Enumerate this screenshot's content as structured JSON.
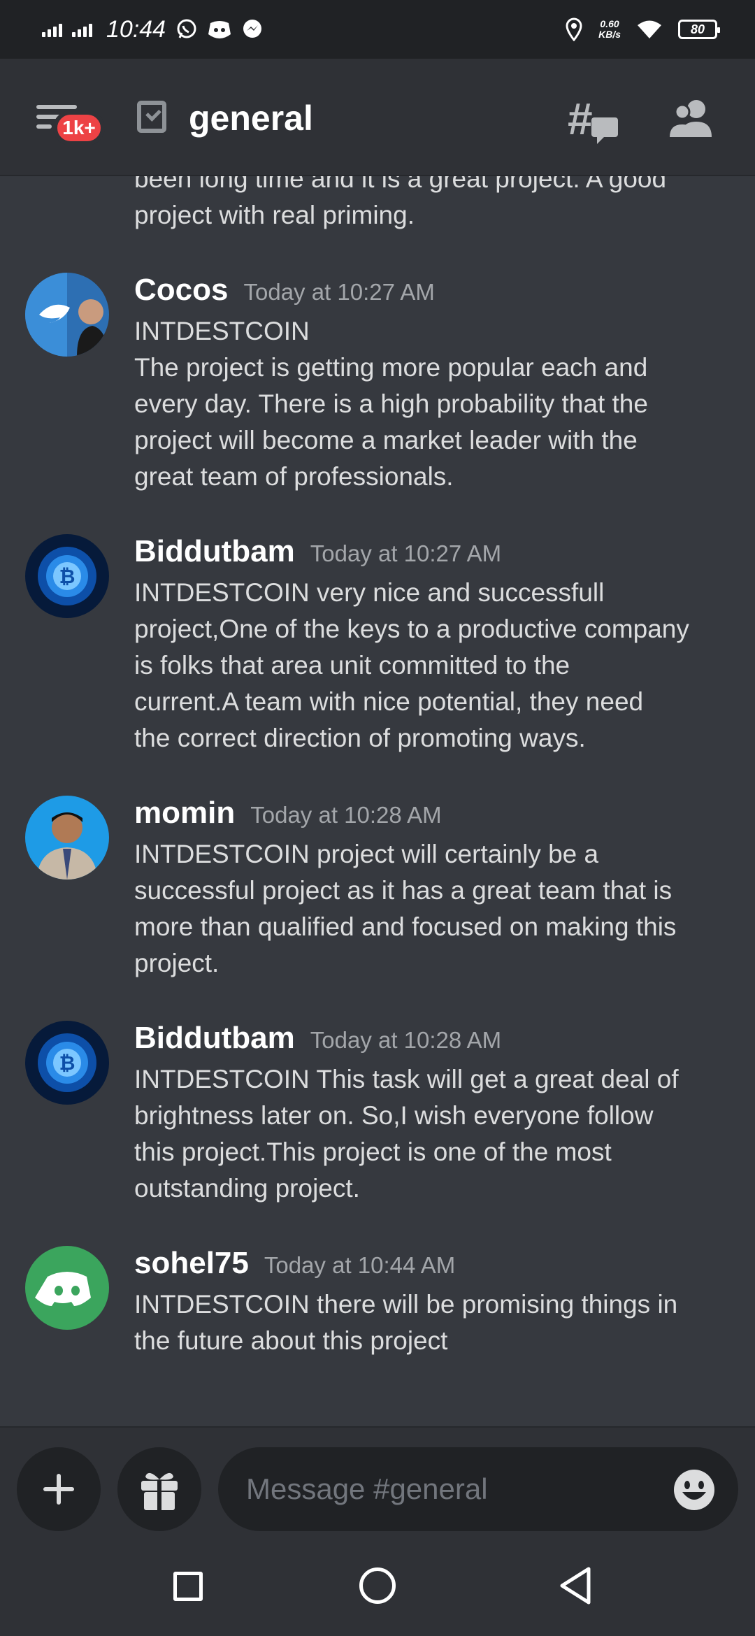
{
  "status_bar": {
    "time": "10:44",
    "network_speed_value": "0.60",
    "network_speed_unit": "KB/s",
    "battery": "80",
    "icons": [
      "signal-icon",
      "signal-icon",
      "whatsapp-icon",
      "discord-notif-icon",
      "messenger-icon",
      "location-icon",
      "wifi-icon",
      "battery-icon"
    ]
  },
  "header": {
    "badge": "1k+",
    "channel_name": "general",
    "icons": [
      "hamburger-menu-icon",
      "channel-icon",
      "threads-icon",
      "members-icon"
    ]
  },
  "messages": {
    "partial_top": [
      "been  long time and it is a great project. A good",
      "project with real priming."
    ],
    "items": [
      {
        "username": "Cocos",
        "timestamp": "Today at 10:27 AM",
        "lines": [
          "INTDESTCOIN",
          "The project is getting more popular each and",
          "every day. There is a high probability that the",
          "project will become a market leader with the",
          "great team of professionals."
        ]
      },
      {
        "username": "Biddutbam",
        "timestamp": "Today at 10:27 AM",
        "lines": [
          "INTDESTCOIN very nice and successfull",
          "project,One of the keys to a productive company",
          "is folks that area unit committed to the",
          "current.A team with nice potential, they need",
          "the correct direction of promoting ways."
        ]
      },
      {
        "username": "momin",
        "timestamp": "Today at 10:28 AM",
        "lines": [
          "INTDESTCOIN project will certainly be a",
          "successful project as it has a great team that is",
          "more than qualified and focused on making this",
          "project."
        ]
      },
      {
        "username": "Biddutbam",
        "timestamp": "Today at 10:28 AM",
        "lines": [
          "INTDESTCOIN This task will get a great deal of",
          "brightness later on. So,I wish everyone follow",
          "this project.This project is one of the most",
          "outstanding project."
        ]
      },
      {
        "username": "sohel75",
        "timestamp": "Today at 10:44 AM",
        "lines": [
          "INTDESTCOIN there will be promising things in",
          "the future about this project"
        ]
      }
    ]
  },
  "composer": {
    "placeholder": "Message #general",
    "value": "",
    "icons": [
      "plus-icon",
      "gift-icon",
      "emoji-icon"
    ]
  },
  "navbar": {
    "icons": [
      "recents-square-icon",
      "home-circle-icon",
      "back-triangle-icon"
    ]
  },
  "colors": {
    "background": "#36393f",
    "header": "#2f3136",
    "status_bar": "#202225",
    "badge": "#ed4245",
    "discord_green": "#3ba55d"
  }
}
